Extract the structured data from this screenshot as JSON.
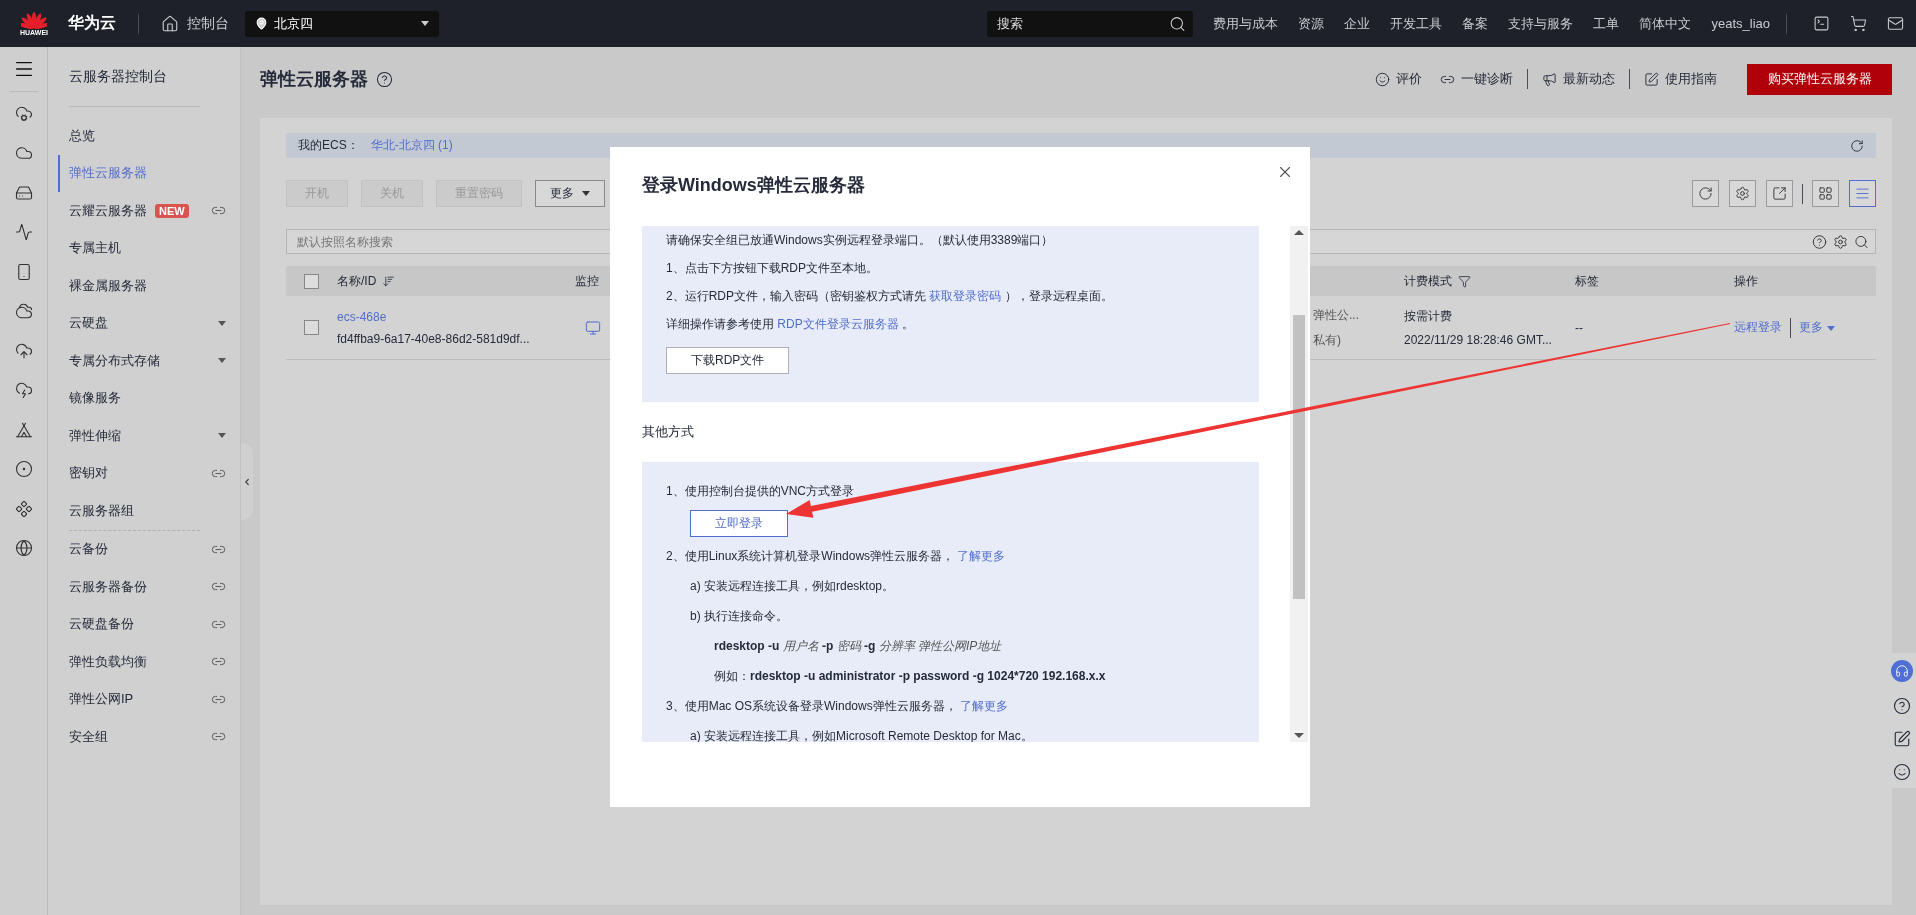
{
  "topbar": {
    "logo_text": "HUAWEI",
    "brand": "华为云",
    "console": "控制台",
    "region": "北京四",
    "search": {
      "placeholder": "搜索"
    },
    "nav": [
      "费用与成本",
      "资源",
      "企业",
      "开发工具",
      "备案",
      "支持与服务",
      "工单",
      "简体中文"
    ],
    "user": "yeats_liao"
  },
  "sidebar": {
    "title": "云服务器控制台",
    "groups": [
      [
        {
          "label": "总览",
          "selected": false,
          "external": false,
          "expandable": false
        },
        {
          "label": "弹性云服务器",
          "selected": true,
          "external": false,
          "expandable": false
        },
        {
          "label": "云耀云服务器",
          "badge": "NEW",
          "selected": false,
          "external": true,
          "expandable": false
        },
        {
          "label": "专属主机",
          "selected": false,
          "external": false,
          "expandable": false
        },
        {
          "label": "裸金属服务器",
          "selected": false,
          "external": false,
          "expandable": false
        },
        {
          "label": "云硬盘",
          "selected": false,
          "external": false,
          "expandable": true
        },
        {
          "label": "专属分布式存储",
          "selected": false,
          "external": false,
          "expandable": true
        },
        {
          "label": "镜像服务",
          "selected": false,
          "external": false,
          "expandable": false
        },
        {
          "label": "弹性伸缩",
          "selected": false,
          "external": false,
          "expandable": true
        },
        {
          "label": "密钥对",
          "selected": false,
          "external": true,
          "expandable": false
        },
        {
          "label": "云服务器组",
          "selected": false,
          "external": false,
          "expandable": false
        }
      ],
      [
        {
          "label": "云备份",
          "selected": false,
          "external": true,
          "expandable": false
        },
        {
          "label": "云服务器备份",
          "selected": false,
          "external": true,
          "expandable": false
        },
        {
          "label": "云硬盘备份",
          "selected": false,
          "external": true,
          "expandable": false
        },
        {
          "label": "弹性负载均衡",
          "selected": false,
          "external": true,
          "expandable": false
        },
        {
          "label": "弹性公网IP",
          "selected": false,
          "external": true,
          "expandable": false
        },
        {
          "label": "安全组",
          "selected": false,
          "external": true,
          "expandable": false
        }
      ]
    ]
  },
  "page": {
    "title": "弹性云服务器",
    "actions": [
      {
        "label": "评价",
        "kind": "rate"
      },
      {
        "label": "一键诊断",
        "kind": "diagnose"
      },
      {
        "label": "最新动态",
        "kind": "news"
      },
      {
        "label": "使用指南",
        "kind": "guide"
      }
    ],
    "buy_button": "购买弹性云服务器"
  },
  "summary": {
    "label": "我的ECS：",
    "link": "华北-北京四 (1)"
  },
  "toolbar": {
    "buttons": [
      {
        "label": "开机",
        "disabled": true,
        "kind": "plain"
      },
      {
        "label": "关机",
        "disabled": true,
        "kind": "plain"
      },
      {
        "label": "重置密码",
        "disabled": true,
        "kind": "plain"
      },
      {
        "label": "更多",
        "disabled": false,
        "kind": "dropdown"
      }
    ],
    "views": [
      {
        "selected": false
      },
      {
        "selected": true
      }
    ]
  },
  "search": {
    "placeholder": "默认按照名称搜索"
  },
  "table": {
    "all_checked": false,
    "columns": [
      {
        "label": "名称/ID",
        "kind": "sortable"
      },
      {
        "label": "监控",
        "kind": "plain"
      },
      {
        "label": "计费模式",
        "kind": "filterable"
      },
      {
        "label": "标签",
        "kind": "plain"
      },
      {
        "label": "操作",
        "kind": "plain"
      }
    ],
    "rows": [
      {
        "checked": false,
        "name": "ecs-468e",
        "id": "fd4ffba9-6a17-40e8-86d2-581d9df...",
        "column_3": [
          "弹性公...",
          "私有)"
        ],
        "billing": "按需计费",
        "created": "2022/11/29 18:28:46 GMT...",
        "tags": "--",
        "actions": [
          "远程登录",
          "更多"
        ]
      }
    ]
  },
  "dialog": {
    "title": "登录Windows弹性云服务器",
    "rdp_section": [
      {
        "kind": "line",
        "parts": [
          {
            "kind": "text",
            "text": "请确保安全组已放通Windows实例远程登录端口。（默认使用3389端口）"
          }
        ]
      },
      {
        "kind": "line",
        "parts": [
          {
            "kind": "text",
            "text": "1、点击下方按钮下载RDP文件至本地。"
          }
        ]
      },
      {
        "kind": "line",
        "parts": [
          {
            "kind": "text",
            "text": "2、运行RDP文件，输入密码（密钥鉴权方式请先 "
          },
          {
            "kind": "link",
            "text": "获取登录密码"
          },
          {
            "kind": "text",
            "text": " ），登录远程桌面。"
          }
        ]
      },
      {
        "kind": "line",
        "parts": [
          {
            "kind": "text",
            "text": "详细操作请参考使用 "
          },
          {
            "kind": "link",
            "text": "RDP文件登录云服务器"
          },
          {
            "kind": "text",
            "text": " 。"
          }
        ]
      },
      {
        "kind": "button",
        "label": "下载RDP文件",
        "primary": false
      }
    ],
    "other_heading": "其他方式",
    "other_section": [
      {
        "kind": "line",
        "parts": [
          {
            "kind": "text",
            "text": "1、使用控制台提供的VNC方式登录"
          }
        ],
        "children": [
          {
            "kind": "button",
            "label": "立即登录",
            "primary": true
          }
        ]
      },
      {
        "kind": "line",
        "parts": [
          {
            "kind": "text",
            "text": "2、使用Linux系统计算机登录Windows弹性云服务器， "
          },
          {
            "kind": "link",
            "text": "了解更多"
          }
        ],
        "children": [
          {
            "kind": "line",
            "parts": [
              {
                "kind": "text",
                "text": "a) 安装远程连接工具，例如rdesktop。"
              }
            ]
          },
          {
            "kind": "line",
            "parts": [
              {
                "kind": "text",
                "text": "b) 执行连接命令。"
              }
            ],
            "children": [
              {
                "kind": "line",
                "parts": [
                  {
                    "kind": "code",
                    "text": "rdesktop -u "
                  },
                  {
                    "kind": "var",
                    "text": "用户名"
                  },
                  {
                    "kind": "code",
                    "text": " -p "
                  },
                  {
                    "kind": "var",
                    "text": "密码"
                  },
                  {
                    "kind": "code",
                    "text": " -g "
                  },
                  {
                    "kind": "var",
                    "text": "分辨率 弹性公网IP地址"
                  }
                ]
              },
              {
                "kind": "line",
                "parts": [
                  {
                    "kind": "text",
                    "text": "例如："
                  },
                  {
                    "kind": "code",
                    "text": "rdesktop -u administrator -p password -g 1024*720 192.168.x.x"
                  }
                ]
              }
            ]
          }
        ]
      },
      {
        "kind": "line",
        "parts": [
          {
            "kind": "text",
            "text": "3、使用Mac OS系统设备登录Windows弹性云服务器， "
          },
          {
            "kind": "link",
            "text": "了解更多"
          }
        ],
        "children": [
          {
            "kind": "line",
            "parts": [
              {
                "kind": "text",
                "text": "a) 安装远程连接工具，例如Microsoft Remote Desktop for Mac。"
              }
            ]
          }
        ]
      }
    ]
  }
}
